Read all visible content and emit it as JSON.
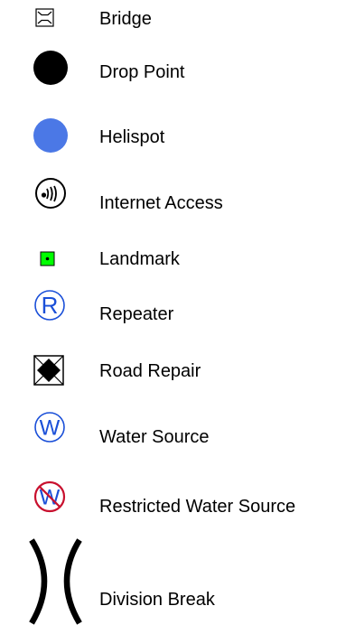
{
  "legend": {
    "items": [
      {
        "key": "bridge",
        "label": "Bridge",
        "icon": "bridge-icon",
        "color": "#000000"
      },
      {
        "key": "drop-point",
        "label": "Drop Point",
        "icon": "filled-circle-icon",
        "color": "#000000"
      },
      {
        "key": "helispot",
        "label": "Helispot",
        "icon": "filled-circle-icon",
        "color": "#4b78e6"
      },
      {
        "key": "internet-access",
        "label": "Internet Access",
        "icon": "wifi-circle-icon",
        "color": "#000000"
      },
      {
        "key": "landmark",
        "label": "Landmark",
        "icon": "square-dot-icon",
        "color": "#00ff00"
      },
      {
        "key": "repeater",
        "label": "Repeater",
        "icon": "r-circle-icon",
        "letter": "R",
        "color": "#1a4fd8"
      },
      {
        "key": "road-repair",
        "label": "Road Repair",
        "icon": "road-repair-icon",
        "color": "#000000"
      },
      {
        "key": "water-source",
        "label": "Water Source",
        "icon": "w-circle-icon",
        "letter": "W",
        "color": "#1a4fd8"
      },
      {
        "key": "restricted-water-source",
        "label": "Restricted Water Source",
        "icon": "restricted-w-circle-icon",
        "letter": "W",
        "color": "#1a4fd8",
        "slash_color": "#c8102e"
      },
      {
        "key": "division-break",
        "label": "Division Break",
        "icon": "division-break-icon",
        "color": "#000000"
      }
    ]
  }
}
